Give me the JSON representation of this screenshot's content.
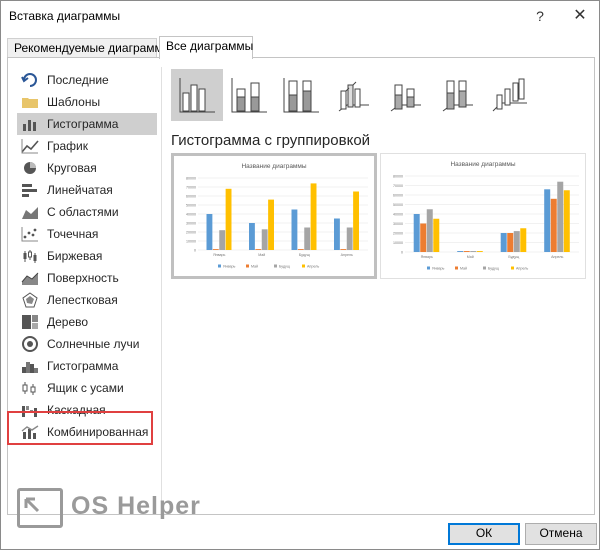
{
  "window": {
    "title": "Вставка диаграммы",
    "help": "?",
    "close": "✕"
  },
  "tabs": {
    "recommended": "Рекомендуемые диаграммы",
    "all": "Все диаграммы"
  },
  "sidebar": {
    "items": [
      {
        "label": "Последние",
        "icon": "recent-icon"
      },
      {
        "label": "Шаблоны",
        "icon": "folder-icon"
      },
      {
        "label": "Гистограмма",
        "icon": "column-chart-icon",
        "selected": true
      },
      {
        "label": "График",
        "icon": "line-chart-icon"
      },
      {
        "label": "Круговая",
        "icon": "pie-chart-icon"
      },
      {
        "label": "Линейчатая",
        "icon": "bar-chart-icon"
      },
      {
        "label": "С областями",
        "icon": "area-chart-icon"
      },
      {
        "label": "Точечная",
        "icon": "scatter-chart-icon"
      },
      {
        "label": "Биржевая",
        "icon": "stock-chart-icon"
      },
      {
        "label": "Поверхность",
        "icon": "surface-chart-icon"
      },
      {
        "label": "Лепестковая",
        "icon": "radar-chart-icon"
      },
      {
        "label": "Дерево",
        "icon": "treemap-chart-icon"
      },
      {
        "label": "Солнечные лучи",
        "icon": "sunburst-chart-icon"
      },
      {
        "label": "Гистограмма",
        "icon": "histogram-chart-icon"
      },
      {
        "label": "Ящик с усами",
        "icon": "box-whisker-chart-icon"
      },
      {
        "label": "Каскадная",
        "icon": "waterfall-chart-icon"
      },
      {
        "label": "Комбинированная",
        "icon": "combo-chart-icon"
      }
    ]
  },
  "subtypes": [
    {
      "icon": "clustered-column-icon",
      "selected": true
    },
    {
      "icon": "stacked-column-icon"
    },
    {
      "icon": "100-stacked-column-icon"
    },
    {
      "icon": "3d-clustered-column-icon"
    },
    {
      "icon": "3d-stacked-column-icon"
    },
    {
      "icon": "3d-100-stacked-column-icon"
    },
    {
      "icon": "3d-column-icon"
    }
  ],
  "selected_chart": {
    "heading": "Гистограмма с группировкой"
  },
  "colors": {
    "blue": "#5b9bd5",
    "orange": "#ed7d31",
    "gray": "#a5a5a5",
    "gold": "#ffc000",
    "selection": "#cfcfcf",
    "highlight": "#e04040"
  },
  "chart_data": [
    {
      "type": "bar",
      "title": "Название диаграммы",
      "categories": [
        "Январь",
        "Май",
        "Будущ",
        "Апрель"
      ],
      "series": [
        {
          "name": "Январь",
          "values": [
            40000,
            30000,
            45000,
            35000
          ]
        },
        {
          "name": "Май",
          "values": [
            1000,
            1000,
            1000,
            1000
          ]
        },
        {
          "name": "Будущ",
          "values": [
            22000,
            23000,
            25000,
            25000
          ]
        },
        {
          "name": "Апрель",
          "values": [
            68000,
            56000,
            74000,
            65000
          ]
        }
      ],
      "ylim": [
        0,
        80000
      ],
      "yticks": [
        "0",
        "10000",
        "20000",
        "30000",
        "40000",
        "50000",
        "60000",
        "70000",
        "80000"
      ],
      "legend": "bottom"
    },
    {
      "type": "bar",
      "title": "Название диаграммы",
      "categories": [
        "Январь",
        "Май",
        "Будущ",
        "Апрель"
      ],
      "series": [
        {
          "name": "Январь",
          "values": [
            40000,
            1000,
            20000,
            66000
          ]
        },
        {
          "name": "Май",
          "values": [
            30000,
            1000,
            20000,
            56000
          ]
        },
        {
          "name": "Будущ",
          "values": [
            45000,
            1000,
            22000,
            74000
          ]
        },
        {
          "name": "Апрель",
          "values": [
            35000,
            1000,
            25000,
            65000
          ]
        }
      ],
      "ylim": [
        0,
        80000
      ],
      "yticks": [
        "0",
        "10000",
        "20000",
        "30000",
        "40000",
        "50000",
        "60000",
        "70000",
        "80000"
      ],
      "legend": "bottom"
    }
  ],
  "watermark": {
    "text": "OS Helper"
  },
  "buttons": {
    "ok": "ОК",
    "cancel": "Отмена"
  }
}
